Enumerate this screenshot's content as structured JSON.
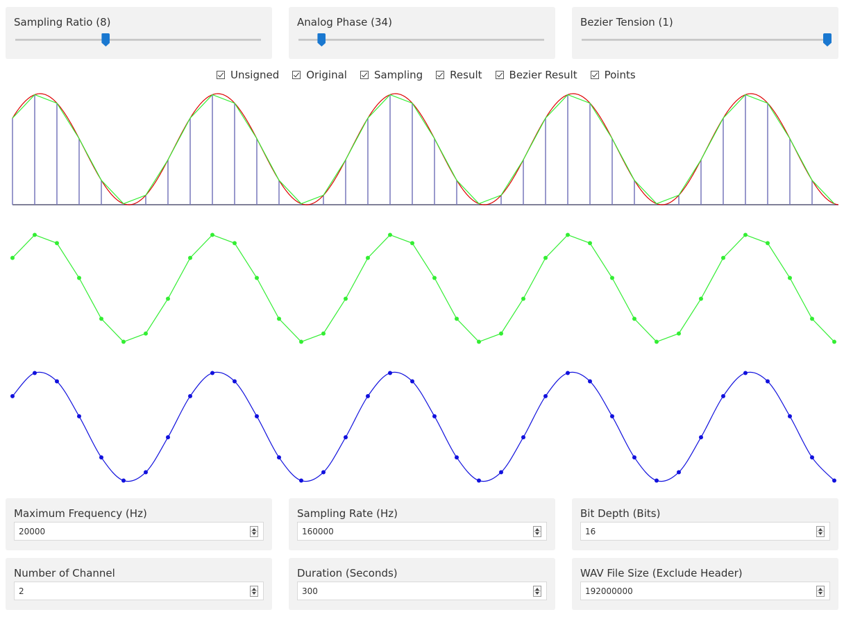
{
  "sliders": [
    {
      "label": "Sampling Ratio (8)",
      "value": 8,
      "min": 1,
      "max": 20
    },
    {
      "label": "Analog Phase (34)",
      "value": 34,
      "min": 0,
      "max": 360
    },
    {
      "label": "Bezier Tension (1)",
      "value": 1,
      "min": 0,
      "max": 1
    }
  ],
  "checkboxes": [
    {
      "label": "Unsigned",
      "checked": true
    },
    {
      "label": "Original",
      "checked": true
    },
    {
      "label": "Sampling",
      "checked": true
    },
    {
      "label": "Result",
      "checked": true
    },
    {
      "label": "Bezier Result",
      "checked": true
    },
    {
      "label": "Points",
      "checked": true
    }
  ],
  "inputs": [
    {
      "label": "Maximum Frequency (Hz)",
      "value": "20000"
    },
    {
      "label": "Sampling Rate (Hz)",
      "value": "160000"
    },
    {
      "label": "Bit Depth (Bits)",
      "value": "16"
    },
    {
      "label": "Number of Channel",
      "value": "2"
    },
    {
      "label": "Duration (Seconds)",
      "value": "300"
    },
    {
      "label": "WAV File Size (Exclude Header)",
      "value": "192000000"
    }
  ],
  "colors": {
    "original": "#dd0000",
    "sampling": "#7777bb",
    "result": "#33ee33",
    "bezier": "#1111dd",
    "accent": "#1a78d0"
  },
  "chart_data": {
    "type": "line",
    "cycles": 5,
    "samples_per_cycle": 8,
    "phase_degrees": 34,
    "bezier_tension": 1
  }
}
